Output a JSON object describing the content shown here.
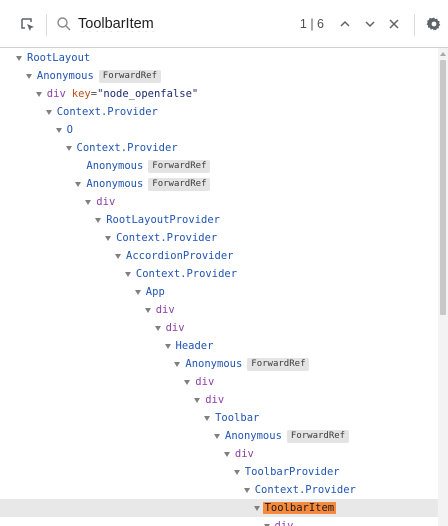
{
  "search": {
    "value": "ToolbarItem",
    "match_count": "1 | 6"
  },
  "icons": {
    "inspect": "select-element-icon",
    "search": "search-icon",
    "prev": "chevron-up-icon",
    "next": "chevron-down-icon",
    "close": "close-icon",
    "settings": "gear-icon"
  },
  "colors": {
    "highlight": "#f58a3c",
    "component": "#2155b2",
    "host": "#8c3fa6",
    "selected_row": "#e8e8e8"
  },
  "tree": {
    "nodes": [
      {
        "label": "RootLayout",
        "depth": 0,
        "type": "comp",
        "expanded": true
      },
      {
        "label": "Anonymous",
        "depth": 1,
        "type": "comp",
        "expanded": true,
        "badge": "ForwardRef"
      },
      {
        "label": "div",
        "depth": 2,
        "type": "host",
        "expanded": true,
        "prop_name": "key",
        "prop_value": "\"node_openfalse\""
      },
      {
        "label": "Context.Provider",
        "depth": 3,
        "type": "comp",
        "expanded": true
      },
      {
        "label": "O",
        "depth": 4,
        "type": "comp",
        "expanded": true
      },
      {
        "label": "Context.Provider",
        "depth": 5,
        "type": "comp",
        "expanded": true
      },
      {
        "label": "Anonymous",
        "depth": 6,
        "type": "comp",
        "expanded": false,
        "badge": "ForwardRef"
      },
      {
        "label": "Anonymous",
        "depth": 6,
        "type": "comp",
        "expanded": true,
        "badge": "ForwardRef"
      },
      {
        "label": "div",
        "depth": 7,
        "type": "host",
        "expanded": true
      },
      {
        "label": "RootLayoutProvider",
        "depth": 8,
        "type": "comp",
        "expanded": true
      },
      {
        "label": "Context.Provider",
        "depth": 9,
        "type": "comp",
        "expanded": true
      },
      {
        "label": "AccordionProvider",
        "depth": 10,
        "type": "comp",
        "expanded": true
      },
      {
        "label": "Context.Provider",
        "depth": 11,
        "type": "comp",
        "expanded": true
      },
      {
        "label": "App",
        "depth": 12,
        "type": "comp",
        "expanded": true
      },
      {
        "label": "div",
        "depth": 13,
        "type": "host",
        "expanded": true
      },
      {
        "label": "div",
        "depth": 14,
        "type": "host",
        "expanded": true
      },
      {
        "label": "Header",
        "depth": 15,
        "type": "comp",
        "expanded": true
      },
      {
        "label": "Anonymous",
        "depth": 16,
        "type": "comp",
        "expanded": true,
        "badge": "ForwardRef"
      },
      {
        "label": "div",
        "depth": 17,
        "type": "host",
        "expanded": true
      },
      {
        "label": "div",
        "depth": 18,
        "type": "host",
        "expanded": true
      },
      {
        "label": "Toolbar",
        "depth": 19,
        "type": "comp",
        "expanded": true
      },
      {
        "label": "Anonymous",
        "depth": 20,
        "type": "comp",
        "expanded": true,
        "badge": "ForwardRef"
      },
      {
        "label": "div",
        "depth": 21,
        "type": "host",
        "expanded": true
      },
      {
        "label": "ToolbarProvider",
        "depth": 22,
        "type": "comp",
        "expanded": true
      },
      {
        "label": "Context.Provider",
        "depth": 23,
        "type": "comp",
        "expanded": true
      },
      {
        "label": "ToolbarItem",
        "depth": 24,
        "type": "comp",
        "expanded": true,
        "selected": true,
        "highlighted": true
      },
      {
        "label": "div",
        "depth": 25,
        "type": "host",
        "expanded": true
      }
    ]
  }
}
